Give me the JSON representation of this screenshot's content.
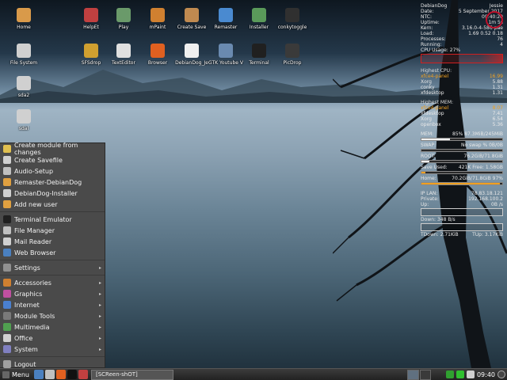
{
  "colors": {
    "accent": "#f0a020",
    "menu_bg": "#4a4a4a",
    "taskbar_bg": "#2e2e2e",
    "conky_red": "#d02020"
  },
  "desktop": {
    "icons": [
      {
        "label": "Home",
        "icon": "folder-icon",
        "color": "#d99a4a"
      },
      {
        "label": "HelpEt",
        "icon": "help-icon",
        "color": "#c04040"
      },
      {
        "label": "Play",
        "icon": "play-icon",
        "color": "#6a9a6a"
      },
      {
        "label": "mPaint",
        "icon": "paint-icon",
        "color": "#d08030"
      },
      {
        "label": "Create Save",
        "icon": "archive-icon",
        "color": "#c08a50"
      },
      {
        "label": "Remaster",
        "icon": "cube-icon",
        "color": "#4a8ad0"
      },
      {
        "label": "Installer",
        "icon": "installer-icon",
        "color": "#5a9a5a"
      },
      {
        "label": "conkytoggle",
        "icon": "chart-icon",
        "color": "#303030"
      },
      {
        "label": "File System",
        "icon": "drive-icon",
        "color": "#d0d0d0"
      },
      {
        "label": "SFSdrop",
        "icon": "sfs-icon",
        "color": "#d0a030"
      },
      {
        "label": "TextEditor",
        "icon": "text-editor-icon",
        "color": "#e0e0e0"
      },
      {
        "label": "Browser",
        "icon": "firefox-icon",
        "color": "#e06020"
      },
      {
        "label": "DebianDog_Je",
        "icon": "debian-icon",
        "color": "#f0f0f0"
      },
      {
        "label": "GTK Youtube V",
        "icon": "youtube-icon",
        "color": "#6a8ab0"
      },
      {
        "label": "Terminal",
        "icon": "terminal-icon",
        "color": "#202020"
      },
      {
        "label": "PicDrop",
        "icon": "picture-icon",
        "color": "#3a3a3a"
      },
      {
        "label": "sda2",
        "icon": "drive-icon",
        "color": "#d0d0d0"
      },
      {
        "label": "sdal",
        "icon": "drive-icon",
        "color": "#d0d0d0"
      }
    ]
  },
  "conky": {
    "header": [
      {
        "k": "DebianDog",
        "v": "Jessie"
      },
      {
        "k": "Date:",
        "v": "5 September 2017"
      },
      {
        "k": "NTC:",
        "v": "09:40:20"
      },
      {
        "k": "Uptime:",
        "v": "1m 5s"
      },
      {
        "k": "Kern:",
        "v": "3.16.0-4-586-pae"
      },
      {
        "k": "Load:",
        "v": "1.69 0.52 0.18"
      },
      {
        "k": "Processes:",
        "v": "76"
      },
      {
        "k": "Running:",
        "v": "4"
      }
    ],
    "cpu_usage": {
      "label": "CPU Usage:",
      "value": "27%",
      "fraction": 0.27
    },
    "high_cpu": {
      "title": "Highest CPU:",
      "rows": [
        {
          "name": "xfce4-panel",
          "val": "16.99",
          "highlight": true
        },
        {
          "name": "Xorg",
          "val": "5.88",
          "highlight": false
        },
        {
          "name": "conky",
          "val": "1.31",
          "highlight": false
        },
        {
          "name": "xfdesktop",
          "val": "1.31",
          "highlight": false
        }
      ]
    },
    "high_mem": {
      "title": "Highest MEM:",
      "rows": [
        {
          "name": "xfce4-panel",
          "val": "8.07",
          "highlight": true
        },
        {
          "name": "xfdesktop",
          "val": "7.41",
          "highlight": false
        },
        {
          "name": "Xorg",
          "val": "6.54",
          "highlight": false
        },
        {
          "name": "openbox",
          "val": "5.36",
          "highlight": false
        }
      ]
    },
    "mem": {
      "label": "MEM:",
      "value": "85% 87.3MiB/245MiB",
      "fraction": 0.35
    },
    "swap": {
      "label": "SWAP:",
      "value": "No swap % 0B/0B",
      "fraction": 0.0
    },
    "root": {
      "label": "ROOT:",
      "value": "76.2GiB/71.8GiB",
      "fraction": 0.1
    },
    "save": {
      "label": "Save Used:",
      "value": "421K Free: 1.58GB",
      "fraction": 0.05
    },
    "home": {
      "label": "Home:",
      "value": "70.2GiB/71.8GiB 97%",
      "fraction": 0.97
    },
    "net": [
      {
        "k": "IP LAN:",
        "v": "78.83.18.121"
      },
      {
        "k": "Private:",
        "v": "192.168.100.2"
      },
      {
        "k": "Up:",
        "v": "0B  /s"
      }
    ],
    "down": {
      "label": "Down:",
      "value": "348 B/s"
    },
    "totals": {
      "down": "TDown: 2.71KiB",
      "up": "TUp: 3.17KiB"
    }
  },
  "menu": {
    "items": [
      {
        "label": "Create module from changes",
        "icon": "module-icon",
        "color": "#e0c050",
        "arrow": false,
        "name": "create-module"
      },
      {
        "label": "Create Savefile",
        "icon": "savefile-icon",
        "color": "#d0d0d0",
        "arrow": false,
        "name": "create-savefile"
      },
      {
        "label": "Audio-Setup",
        "icon": "audio-icon",
        "color": "#c0c0c0",
        "arrow": false,
        "name": "audio-setup"
      },
      {
        "label": "Remaster-DebianDog",
        "icon": "remaster-icon",
        "color": "#e0a040",
        "arrow": false,
        "name": "remaster"
      },
      {
        "label": "DebianDog-Installer",
        "icon": "installer-icon",
        "color": "#d0d0d0",
        "arrow": false,
        "name": "installer"
      },
      {
        "label": "Add new user",
        "icon": "user-icon",
        "color": "#e0a040",
        "arrow": false,
        "name": "add-user"
      },
      {
        "sep": true
      },
      {
        "label": "Terminal Emulator",
        "icon": "terminal-icon",
        "color": "#202020",
        "arrow": false,
        "name": "terminal"
      },
      {
        "label": "File Manager",
        "icon": "file-manager-icon",
        "color": "#c0c0c0",
        "arrow": false,
        "name": "file-manager"
      },
      {
        "label": "Mail Reader",
        "icon": "mail-icon",
        "color": "#d0d0d0",
        "arrow": false,
        "name": "mail-reader"
      },
      {
        "label": "Web Browser",
        "icon": "globe-icon",
        "color": "#4a80c0",
        "arrow": false,
        "name": "web-browser"
      },
      {
        "sep": true
      },
      {
        "label": "Settings",
        "icon": "settings-icon",
        "color": "#909090",
        "arrow": true,
        "name": "settings"
      },
      {
        "sep": true
      },
      {
        "label": "Accessories",
        "icon": "accessories-icon",
        "color": "#d08030",
        "arrow": true,
        "name": "accessories"
      },
      {
        "label": "Graphics",
        "icon": "graphics-icon",
        "color": "#c050a0",
        "arrow": true,
        "name": "graphics"
      },
      {
        "label": "Internet",
        "icon": "internet-icon",
        "color": "#4a80d0",
        "arrow": true,
        "name": "internet"
      },
      {
        "label": "Module Tools",
        "icon": "module-tools-icon",
        "color": "#7a7a7a",
        "arrow": true,
        "name": "module-tools"
      },
      {
        "label": "Multimedia",
        "icon": "multimedia-icon",
        "color": "#50a050",
        "arrow": true,
        "name": "multimedia"
      },
      {
        "label": "Office",
        "icon": "office-icon",
        "color": "#d0d0d0",
        "arrow": true,
        "name": "office"
      },
      {
        "label": "System",
        "icon": "system-icon",
        "color": "#8080c0",
        "arrow": true,
        "name": "system"
      },
      {
        "sep": true
      },
      {
        "label": "Logout",
        "icon": "logout-icon",
        "color": "#a0a0a0",
        "arrow": false,
        "name": "logout"
      }
    ]
  },
  "taskbar": {
    "menu_label": "Menu",
    "launchers": [
      {
        "icon": "desktop-icon",
        "color": "#4a80c0"
      },
      {
        "icon": "files-icon",
        "color": "#c0c0c0"
      },
      {
        "icon": "firefox-icon",
        "color": "#e06020"
      },
      {
        "icon": "terminal-icon",
        "color": "#111111"
      },
      {
        "icon": "screenshot-icon",
        "color": "#c04040"
      }
    ],
    "task_label": "[SCReen-shOT]",
    "tray": [
      {
        "icon": "tray-app-icon",
        "color": "#30a030"
      },
      {
        "icon": "network-icon",
        "color": "#30c030"
      },
      {
        "icon": "volume-icon",
        "color": "#d0d0d0"
      }
    ],
    "clock": "09:40"
  }
}
